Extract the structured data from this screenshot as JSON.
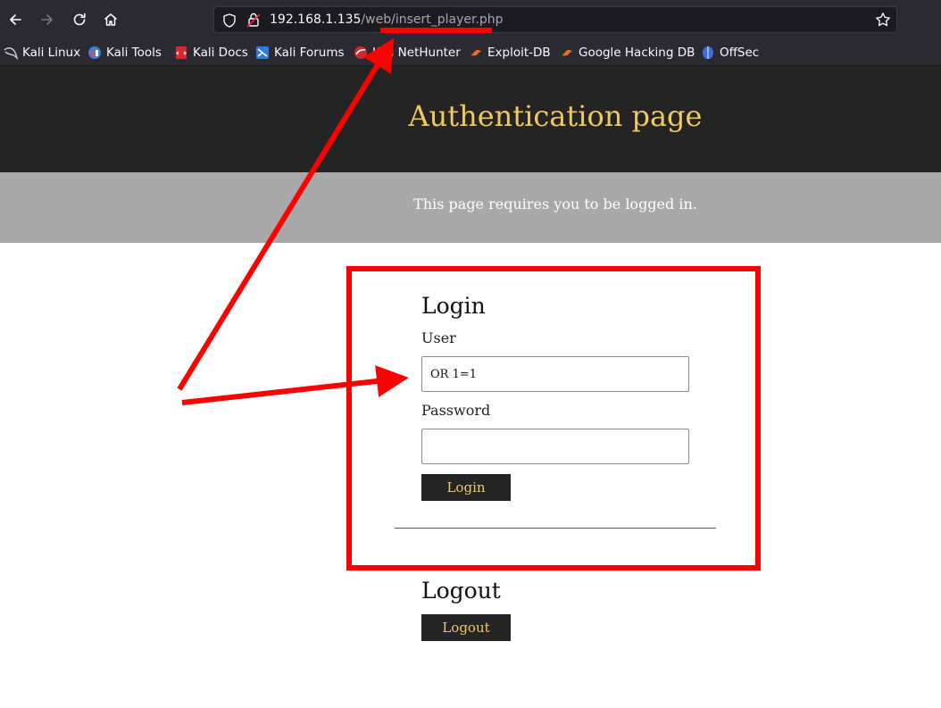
{
  "browser": {
    "url_host": "192.168.1.135",
    "url_path": "/web/insert_player.php",
    "bookmarks": [
      {
        "label": "Kali Linux",
        "icon": "kali-dragon-icon"
      },
      {
        "label": "Kali Tools",
        "icon": "kali-tools-icon"
      },
      {
        "label": "Kali Docs",
        "icon": "kali-docs-icon"
      },
      {
        "label": "Kali Forums",
        "icon": "kali-forums-icon"
      },
      {
        "label": "Kali NetHunter",
        "icon": "kali-nethunter-icon"
      },
      {
        "label": "Exploit-DB",
        "icon": "exploit-db-icon"
      },
      {
        "label": "Google Hacking DB",
        "icon": "ghdb-icon"
      },
      {
        "label": "OffSec",
        "icon": "offsec-icon"
      }
    ]
  },
  "page": {
    "title": "Authentication page",
    "notice": "This page requires you to be logged in."
  },
  "login": {
    "heading": "Login",
    "user_label": "User",
    "user_value": "OR 1=1",
    "password_label": "Password",
    "password_value": "",
    "button_label": "Login"
  },
  "logout": {
    "heading": "Logout",
    "button_label": "Logout"
  },
  "colors": {
    "header_bg": "#242424",
    "accent_gold": "#f2c95c",
    "notice_bg": "#a8a8a8",
    "annotation_red": "#ff0000"
  }
}
